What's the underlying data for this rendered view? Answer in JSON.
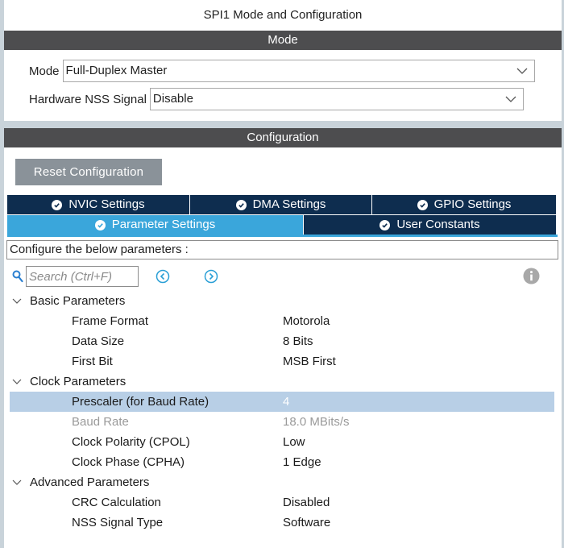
{
  "window": {
    "title": "SPI1 Mode and Configuration"
  },
  "mode_section": {
    "header": "Mode",
    "mode_label": "Mode",
    "mode_value": "Full-Duplex Master",
    "nss_label": "Hardware NSS Signal",
    "nss_value": "Disable"
  },
  "config_section": {
    "header": "Configuration",
    "reset_button": "Reset Configuration"
  },
  "tabs": {
    "row1": [
      "NVIC Settings",
      "DMA Settings",
      "GPIO Settings"
    ],
    "row2": [
      "Parameter Settings",
      "User Constants"
    ],
    "active": "Parameter Settings"
  },
  "configure_text": "Configure the below parameters :",
  "search": {
    "placeholder": "Search (Ctrl+F)"
  },
  "groups": [
    {
      "label": "Basic Parameters",
      "params": [
        {
          "name": "Frame Format",
          "value": "Motorola"
        },
        {
          "name": "Data Size",
          "value": "8 Bits"
        },
        {
          "name": "First Bit",
          "value": "MSB First"
        }
      ]
    },
    {
      "label": "Clock Parameters",
      "params": [
        {
          "name": "Prescaler (for Baud Rate)",
          "value": "4",
          "selected": true
        },
        {
          "name": "Baud Rate",
          "value": "18.0 MBits/s",
          "disabled": true
        },
        {
          "name": "Clock Polarity (CPOL)",
          "value": "Low"
        },
        {
          "name": "Clock Phase (CPHA)",
          "value": "1 Edge"
        }
      ]
    },
    {
      "label": "Advanced Parameters",
      "params": [
        {
          "name": "CRC Calculation",
          "value": "Disabled"
        },
        {
          "name": "NSS Signal Type",
          "value": "Software"
        }
      ]
    }
  ],
  "colors": {
    "section_header": "#4d4d4f",
    "tab_dark": "#0e2d4f",
    "tab_active": "#3aa6db",
    "selected_row": "#b8cfe6",
    "reset_button": "#8a9299"
  }
}
